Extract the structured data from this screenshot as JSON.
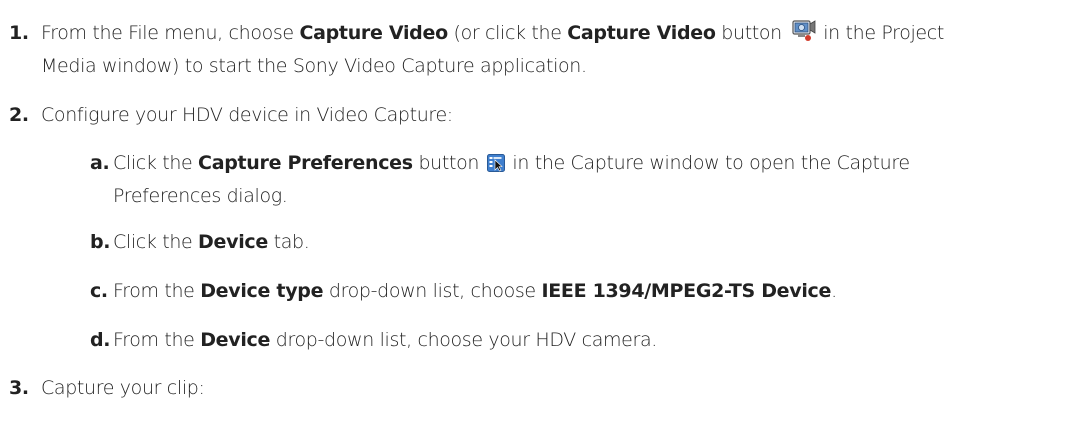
{
  "steps": [
    {
      "num": "1.",
      "parts": {
        "t1": "From the File menu, choose ",
        "b1": "Capture Video",
        "t2": " (or click the ",
        "b2": "Capture Video",
        "t3": " button ",
        "t4": " in the Project",
        "t5": "Media window) to start the Sony Video Capture application."
      },
      "icon": "capture-video-icon"
    },
    {
      "num": "2.",
      "text": "Configure your HDV device in Video Capture:",
      "substeps": [
        {
          "letter": "a.",
          "parts": {
            "t1": "Click the ",
            "b1": "Capture Preferences",
            "t2": " button ",
            "t3": " in the Capture window to open the Capture",
            "t4": "Preferences dialog."
          },
          "icon": "capture-preferences-icon"
        },
        {
          "letter": "b.",
          "parts": {
            "t1": "Click the ",
            "b1": "Device",
            "t2": " tab."
          }
        },
        {
          "letter": "c.",
          "parts": {
            "t1": "From the ",
            "b1": "Device type",
            "t2": " drop-down list, choose ",
            "b2": "IEEE 1394/MPEG2-TS Device",
            "t3": "."
          }
        },
        {
          "letter": "d.",
          "parts": {
            "t1": "From the ",
            "b1": "Device",
            "t2": " drop-down list, choose your HDV camera."
          }
        }
      ]
    },
    {
      "num": "3.",
      "text": "Capture your clip:"
    }
  ]
}
